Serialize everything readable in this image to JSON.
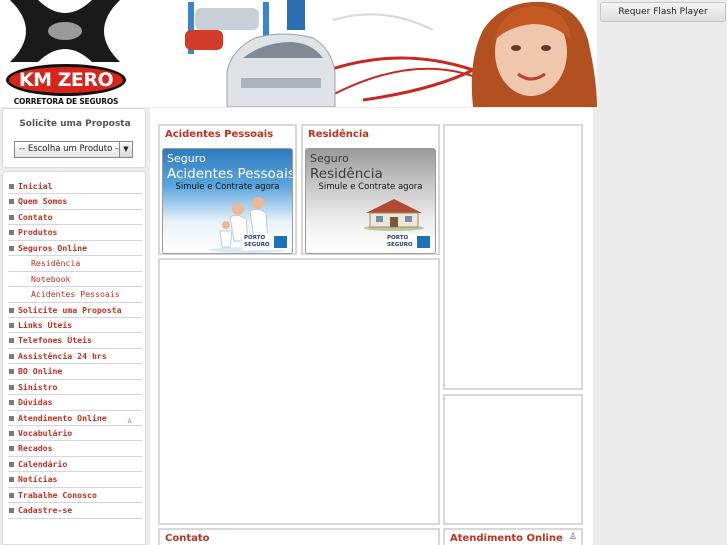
{
  "logo": {
    "name": "KM ZERO",
    "tagline": "CORRETORA DE SEGUROS"
  },
  "flash": {
    "label": "Requer Flash Player"
  },
  "proposal": {
    "title": "Solicite uma Proposta",
    "select_value": "-- Escolha um Produto --"
  },
  "menu": {
    "items": [
      {
        "label": "Inicial",
        "type": "main"
      },
      {
        "label": "Quem Somos",
        "type": "main"
      },
      {
        "label": "Contato",
        "type": "main"
      },
      {
        "label": "Produtos",
        "type": "main"
      },
      {
        "label": "Seguros Online",
        "type": "main"
      },
      {
        "label": "Residência",
        "type": "sub"
      },
      {
        "label": "Notebook",
        "type": "sub"
      },
      {
        "label": "Acidentes Pessoais",
        "type": "sub"
      },
      {
        "label": "Solicite uma Proposta",
        "type": "main"
      },
      {
        "label": "Links Úteis",
        "type": "main"
      },
      {
        "label": "Telefones Úteis",
        "type": "main"
      },
      {
        "label": "Assistência 24 hrs",
        "type": "main"
      },
      {
        "label": "BO Online",
        "type": "main"
      },
      {
        "label": "Sinistro",
        "type": "main"
      },
      {
        "label": "Dúvidas",
        "type": "main"
      },
      {
        "label": "Atendimento Online",
        "type": "main"
      },
      {
        "label": "Vocabulário",
        "type": "main"
      },
      {
        "label": "Recados",
        "type": "main"
      },
      {
        "label": "Calendário",
        "type": "main"
      },
      {
        "label": "Notícias",
        "type": "main"
      },
      {
        "label": "Trabalhe Conosco",
        "type": "main"
      },
      {
        "label": "Cadastre-se",
        "type": "main"
      }
    ]
  },
  "panels": {
    "acidentes": {
      "title": "Acidentes Pessoais",
      "line1": "Seguro",
      "line2": "Acidentes Pessoais",
      "line3": "Simule e Contrate agora"
    },
    "residencia": {
      "title": "Residência",
      "line1": "Seguro",
      "line2": "Residência",
      "line3": "Simule e Contrate agora"
    },
    "porto_top": "PORTO",
    "porto_bottom": "SEGURO",
    "contato": {
      "title": "Contato"
    },
    "atendimento": {
      "title": "Atendimento Online"
    }
  },
  "colors": {
    "accent": "#c0301f",
    "brand_red": "#d9241b",
    "promo_blue": "#1a73b9"
  }
}
